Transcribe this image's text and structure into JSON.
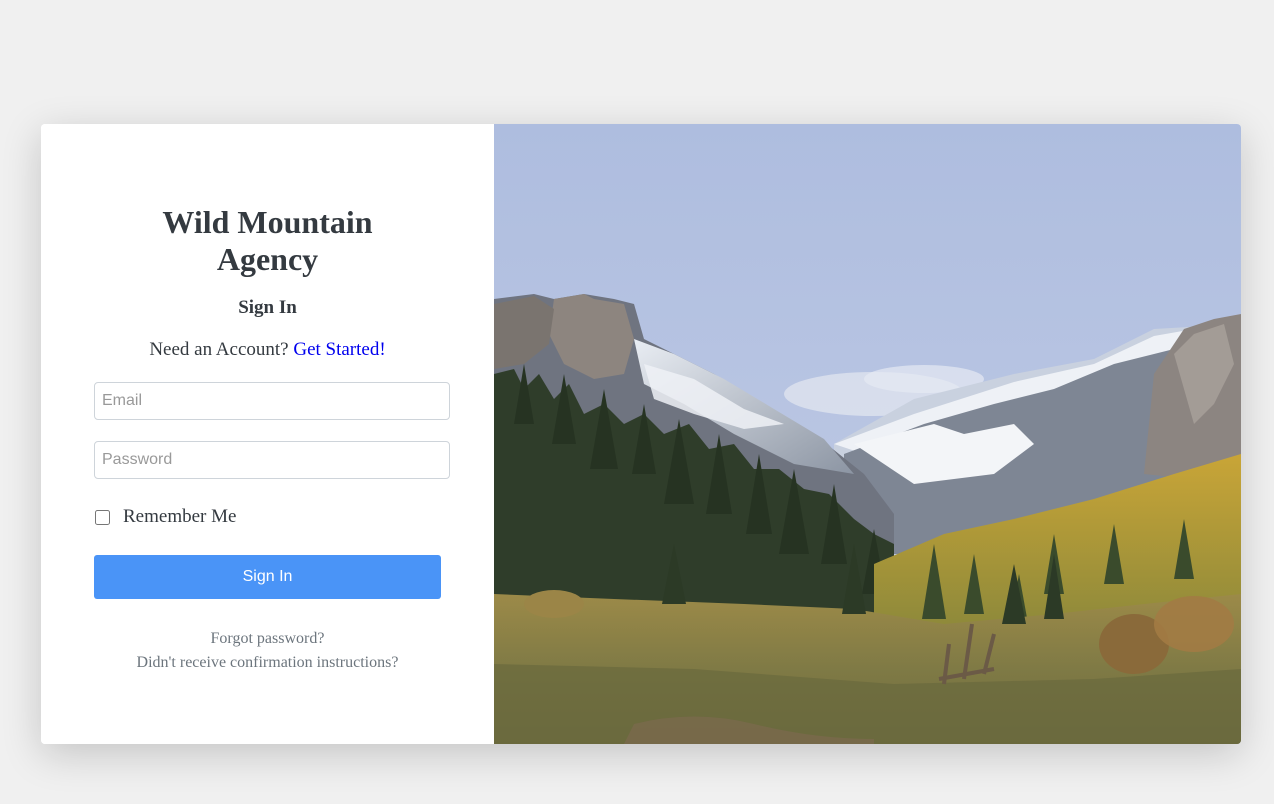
{
  "brand": {
    "title_line1": "Wild Mountain",
    "title_line2": "Agency"
  },
  "form": {
    "heading": "Sign In",
    "account_prompt": "Need an Account?",
    "get_started_link": "Get Started!",
    "email_placeholder": "Email",
    "email_value": "",
    "password_placeholder": "Password",
    "password_value": "",
    "remember_label": "Remember Me",
    "remember_checked": false,
    "submit_label": "Sign In"
  },
  "links": {
    "forgot_password": "Forgot password?",
    "confirmation": "Didn't receive confirmation instructions?"
  },
  "colors": {
    "accent": "#4a94f7",
    "link": "#0000ee",
    "text": "#343a40",
    "muted": "#6c757d",
    "background": "#f0f0f0"
  },
  "hero_image": "mountain-landscape-photo"
}
